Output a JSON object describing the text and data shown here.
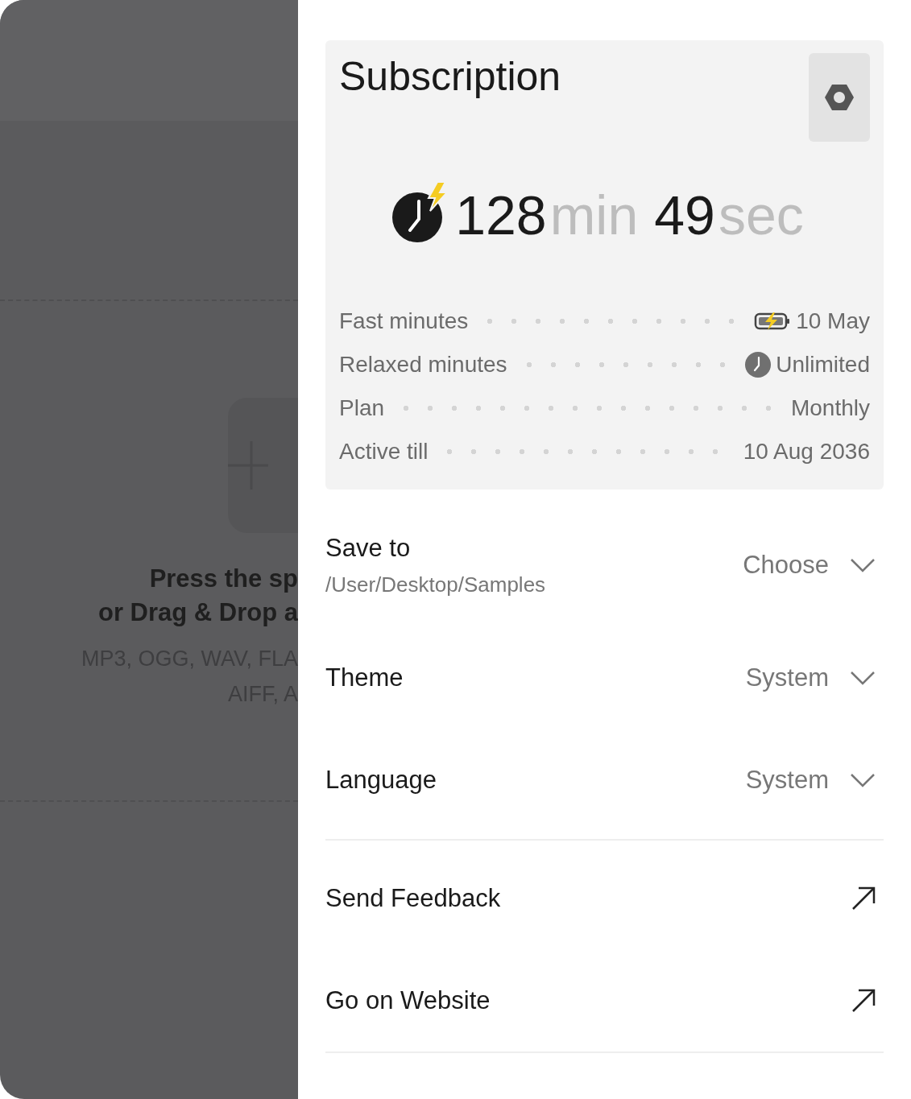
{
  "background": {
    "upload_hint": [
      "Press the sp",
      "or Drag & Drop a"
    ],
    "formats": [
      "MP3, OGG, WAV, FLA",
      "AIFF, A"
    ]
  },
  "subscription": {
    "title": "Subscription",
    "time": {
      "minutes": "128",
      "min_unit": "min",
      "seconds": "49",
      "sec_unit": "sec"
    },
    "details": [
      {
        "label": "Fast minutes",
        "value": "10 May",
        "kind": "battery"
      },
      {
        "label": "Relaxed minutes",
        "value": "Unlimited",
        "kind": "clock"
      },
      {
        "label": "Plan",
        "value": "Monthly",
        "kind": "plain"
      },
      {
        "label": "Active till",
        "value": "10 Aug 2036",
        "kind": "plain"
      }
    ]
  },
  "settings": [
    {
      "label": "Save to",
      "sublabel": "/User/Desktop/Samples",
      "value": "Choose"
    },
    {
      "label": "Theme",
      "value": "System"
    },
    {
      "label": "Language",
      "value": "System"
    }
  ],
  "links": [
    {
      "label": "Send Feedback"
    },
    {
      "label": "Go on Website"
    }
  ]
}
